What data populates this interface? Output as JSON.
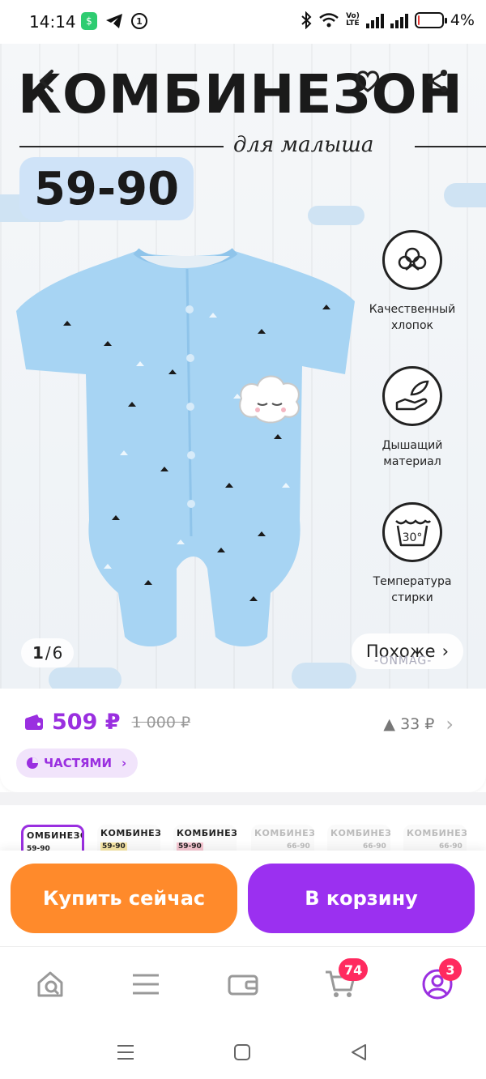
{
  "status_bar": {
    "time": "14:14",
    "app_badge": "$",
    "sim_badge": "1",
    "volte_top": "Vo)",
    "volte_bottom": "LTE",
    "battery_percent": "4%",
    "battery_level": 0.04
  },
  "gallery": {
    "heading": "КОМБИНЕЗОН",
    "subheading": "для малыша",
    "size_range": "59-90",
    "features": [
      {
        "icon": "cotton-icon",
        "label": "Качественный хлопок"
      },
      {
        "icon": "feather-hand-icon",
        "label": "Дышащий материал"
      },
      {
        "icon": "wash-30-icon",
        "label": "Температура стирки",
        "icon_text": "30°"
      }
    ],
    "page_current": "1",
    "page_separator": "/",
    "page_total": "6",
    "similar_label": "Похоже",
    "similar_chevron": "›",
    "watermark": "-ONMAG-"
  },
  "price": {
    "current": "509 ₽",
    "old": "1 000 ₽",
    "delta": "▲ 33 ₽",
    "delta_chevron": "›",
    "installments_label": "ЧАСТЯМИ",
    "installments_chevron": "›",
    "accent_color": "#9a2fe0"
  },
  "variants": [
    {
      "title": "ОМБИНЕЗО",
      "size": "59-90",
      "selected": true
    },
    {
      "title": "КОМБИНЕЗОН",
      "size": "59-90"
    },
    {
      "title": "КОМБИНЕЗОН",
      "size": "59-90"
    },
    {
      "title": "КОМБИНЕЗОН",
      "size": "66-90"
    },
    {
      "title": "КОМБИНЕЗОН",
      "size": "66-90"
    },
    {
      "title": "КОМБИНЕЗОН",
      "size": "66-90"
    }
  ],
  "actions": {
    "buy_now": "Купить сейчас",
    "add_to_cart": "В корзину",
    "buy_color": "#ff8a2b",
    "cart_color": "#9b30f0"
  },
  "bottom_nav": {
    "items": [
      {
        "icon": "home-search-icon"
      },
      {
        "icon": "catalog-icon"
      },
      {
        "icon": "wallet-icon"
      },
      {
        "icon": "cart-icon",
        "badge": "74"
      },
      {
        "icon": "profile-icon",
        "badge": "3"
      }
    ]
  }
}
